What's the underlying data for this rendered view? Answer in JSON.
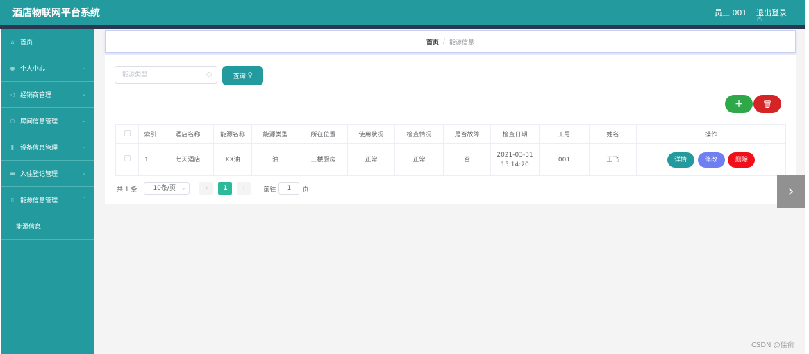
{
  "header": {
    "title": "酒店物联网平台系统",
    "user": "员工 001",
    "logout": "退出登录"
  },
  "sidebar": {
    "items": [
      {
        "label": "首页",
        "icon": "home-icon",
        "expandable": false
      },
      {
        "label": "个人中心",
        "icon": "user-icon",
        "expandable": true
      },
      {
        "label": "经销商管理",
        "icon": "send-icon",
        "expandable": true
      },
      {
        "label": "房间信息管理",
        "icon": "clock-icon",
        "expandable": true
      },
      {
        "label": "设备信息管理",
        "icon": "chart-icon",
        "expandable": true
      },
      {
        "label": "入住登记管理",
        "icon": "card-icon",
        "expandable": true
      },
      {
        "label": "能源信息管理",
        "icon": "phone-icon",
        "expandable": true
      }
    ],
    "subitem": "能源信息"
  },
  "breadcrumb": {
    "home": "首页",
    "separator": "/",
    "current": "能源信息"
  },
  "search": {
    "placeholder": "能源类型",
    "button": "查询"
  },
  "table": {
    "headers": [
      "索引",
      "酒店名称",
      "能源名称",
      "能源类型",
      "所在位置",
      "使用状况",
      "检查情况",
      "是否故障",
      "检查日期",
      "工号",
      "姓名",
      "操作"
    ],
    "rows": [
      {
        "index": "1",
        "hotel": "七天酒店",
        "energy_name": "XX油",
        "energy_type": "油",
        "location": "三楼厨房",
        "usage": "正常",
        "check": "正常",
        "fault": "否",
        "date": "2021-03-31",
        "time": "15:14:20",
        "staff_no": "001",
        "name": "王飞"
      }
    ],
    "actions": {
      "detail": "详情",
      "edit": "修改",
      "delete": "删除"
    }
  },
  "pagination": {
    "total": "共 1 条",
    "page_size": "10条/页",
    "current_page": "1",
    "goto_label": "前往",
    "goto_value": "1",
    "page_suffix": "页"
  },
  "watermark": "CSDN @佳俞",
  "colors": {
    "primary": "#239b9e",
    "add": "#2fa84a",
    "delete": "#d42426",
    "edit": "#6f7ef0"
  }
}
